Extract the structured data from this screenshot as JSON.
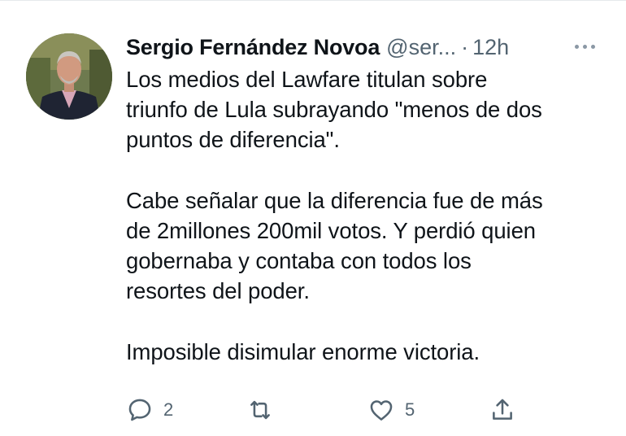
{
  "tweet": {
    "author_name": "Sergio Fernández Novoa",
    "handle": "@ser...",
    "separator": "·",
    "time": "12h",
    "paragraphs": [
      [
        "Los medios del Lawfare titulan sobre",
        "triunfo de Lula subrayando \"menos de dos",
        "puntos de diferencia\"."
      ],
      [
        "Cabe señalar que la diferencia fue de más",
        "de 2millones 200mil votos. Y perdió quien",
        "gobernaba y contaba con todos los",
        "resortes del poder."
      ],
      [
        "Imposible disimular enorme victoria."
      ]
    ],
    "reply_count": "2",
    "retweet_count": "",
    "like_count": "5"
  },
  "icons": {
    "more": "more-dots-icon",
    "reply": "reply-bubble-icon",
    "retweet": "retweet-arrows-icon",
    "like": "heart-icon",
    "share": "share-upload-icon"
  },
  "colors": {
    "text": "#0f1419",
    "secondary": "#536471",
    "background": "#ffffff"
  }
}
